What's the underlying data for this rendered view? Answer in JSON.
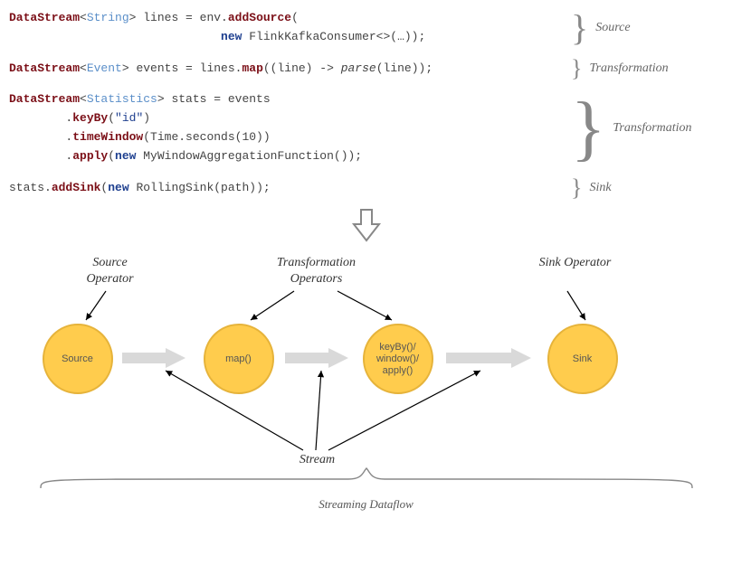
{
  "code": {
    "block1": {
      "line1_pre": "DataStream",
      "line1_generic": "String",
      "line1_mid": "> lines = env.",
      "line1_method": "addSource",
      "line1_post": "(",
      "line2_indent": "                              ",
      "line2_new": "new",
      "line2_rest": " FlinkKafkaConsumer<>(…));",
      "label": "Source"
    },
    "block2": {
      "line_pre": "DataStream",
      "line_generic": "Event",
      "line_mid": "> events = lines.",
      "line_method": "map",
      "line_paren": "((line) -> ",
      "line_ital": "parse",
      "line_end": "(line));",
      "label": "Transformation"
    },
    "block3": {
      "l1_pre": "DataStream",
      "l1_generic": "Statistics",
      "l1_post": "> stats = events",
      "l2_indent": "        .",
      "l2_method": "keyBy",
      "l2_arg": "(",
      "l2_str": "\"id\"",
      "l2_end": ")",
      "l3_indent": "        .",
      "l3_method": "timeWindow",
      "l3_arg": "(Time.seconds(10))",
      "l4_indent": "        .",
      "l4_method": "apply",
      "l4_paren": "(",
      "l4_new": "new",
      "l4_rest": " MyWindowAggregationFunction());",
      "label": "Transformation"
    },
    "block4": {
      "line_pre": "stats.",
      "line_method": "addSink",
      "line_paren": "(",
      "line_new": "new",
      "line_rest": " RollingSink(path));",
      "label": "Sink"
    }
  },
  "diagram": {
    "labels": {
      "source_op": "Source\nOperator",
      "trans_op": "Transformation\nOperators",
      "sink_op": "Sink\nOperator",
      "stream": "Stream",
      "dataflow": "Streaming Dataflow"
    },
    "circles": {
      "source": "Source",
      "map": "map()",
      "keyby": "keyBy()/\nwindow()/\napply()",
      "sink": "Sink"
    }
  }
}
